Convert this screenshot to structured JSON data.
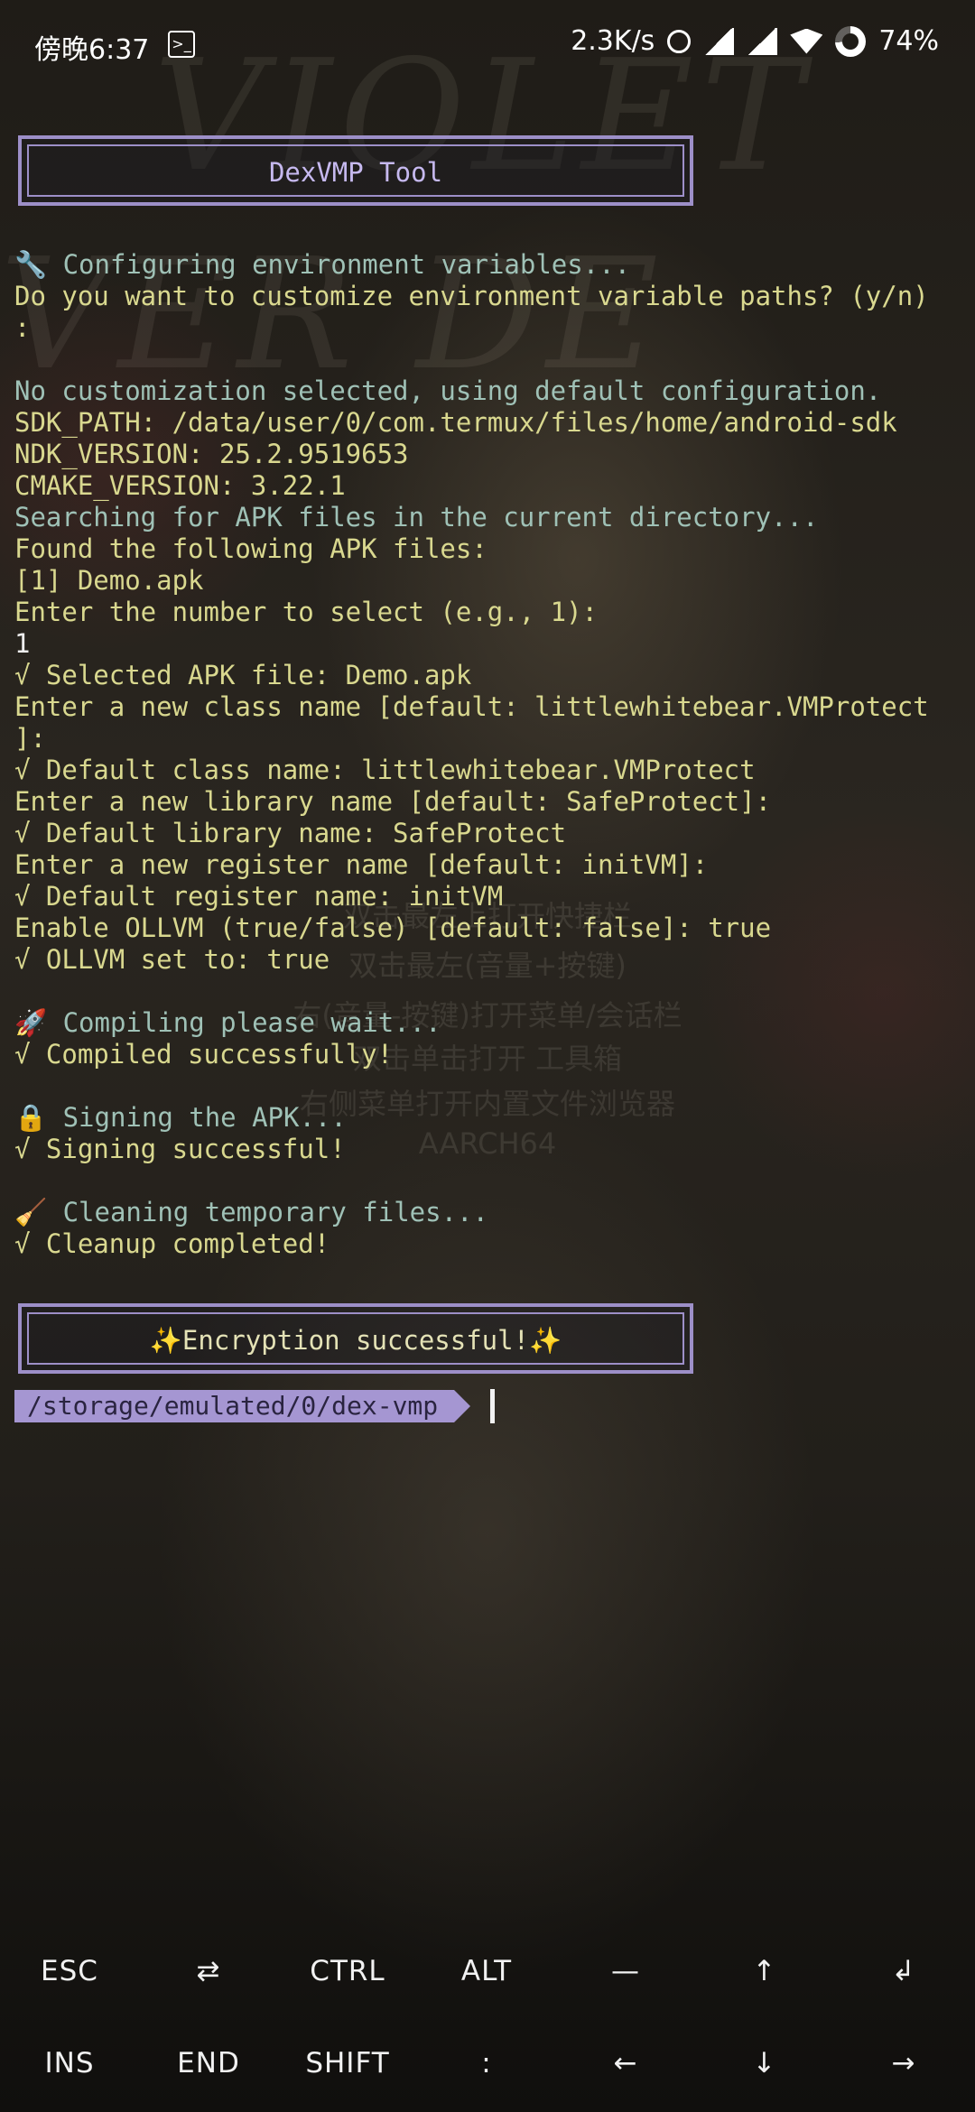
{
  "status_bar": {
    "time": "傍晚6:37",
    "network_speed": "2.3K/s",
    "battery": "74%",
    "battery_level": 0.74,
    "icons": [
      "terminal-notification-icon",
      "alarm-icon",
      "signal-icon",
      "signal-icon",
      "wifi-icon",
      "battery-icon"
    ]
  },
  "background": {
    "watermark_top": "VIOLET",
    "watermark_mid": "VER        DE",
    "menu_hints": [
      "双击最左(音量+按键)",
      "右(音量-按键)打开菜单/会话栏",
      "双击单击打开 工具箱",
      "右侧菜单打开内置文件浏览器",
      "AARCH64"
    ],
    "menu_hint_top_partial": "双击最左上打开快捷栏"
  },
  "terminal": {
    "banner_title": "DexVMP Tool",
    "lines": [
      {
        "text": "🔧 Configuring environment variables...",
        "cls": "c-cyan"
      },
      {
        "text": "Do you want to customize environment variable paths? (y/n)",
        "cls": "c-yellow"
      },
      {
        "text": ":",
        "cls": "c-yellow"
      },
      {
        "text": "",
        "cls": ""
      },
      {
        "text": "No customization selected, using default configuration.",
        "cls": "c-cyan"
      },
      {
        "text": "SDK_PATH: /data/user/0/com.termux/files/home/android-sdk",
        "cls": "c-yellow"
      },
      {
        "text": "NDK_VERSION: 25.2.9519653",
        "cls": "c-yellow"
      },
      {
        "text": "CMAKE_VERSION: 3.22.1",
        "cls": "c-yellow"
      },
      {
        "text": "Searching for APK files in the current directory...",
        "cls": "c-cyan"
      },
      {
        "text": "Found the following APK files:",
        "cls": "c-yellow"
      },
      {
        "text": "[1] Demo.apk",
        "cls": "c-yellow"
      },
      {
        "text": "Enter the number to select (e.g., 1):",
        "cls": "c-yellow"
      },
      {
        "text": "1",
        "cls": "c-white"
      },
      {
        "text": "√ Selected APK file: Demo.apk",
        "cls": "c-yellow"
      },
      {
        "text": "Enter a new class name [default: littlewhitebear.VMProtect",
        "cls": "c-yellow"
      },
      {
        "text": "]:",
        "cls": "c-yellow"
      },
      {
        "text": "√ Default class name: littlewhitebear.VMProtect",
        "cls": "c-yellow"
      },
      {
        "text": "Enter a new library name [default: SafeProtect]:",
        "cls": "c-yellow"
      },
      {
        "text": "√ Default library name: SafeProtect",
        "cls": "c-yellow"
      },
      {
        "text": "Enter a new register name [default: initVM]:",
        "cls": "c-yellow"
      },
      {
        "text": "√ Default register name: initVM",
        "cls": "c-yellow"
      },
      {
        "text": "Enable OLLVM (true/false) [default: false]: true",
        "cls": "c-yellow"
      },
      {
        "text": "√ OLLVM set to: true",
        "cls": "c-yellow"
      },
      {
        "text": "",
        "cls": ""
      },
      {
        "text": "🚀 Compiling please wait...",
        "cls": "c-cyan"
      },
      {
        "text": "√ Compiled successfully!",
        "cls": "c-yellow"
      },
      {
        "text": "",
        "cls": ""
      },
      {
        "text": "🔒 Signing the APK...",
        "cls": "c-cyan"
      },
      {
        "text": "√ Signing successful!",
        "cls": "c-yellow"
      },
      {
        "text": "",
        "cls": ""
      },
      {
        "text": "🧹 Cleaning temporary files...",
        "cls": "c-cyan"
      },
      {
        "text": "√ Cleanup completed!",
        "cls": "c-yellow"
      }
    ],
    "success_banner": "✨Encryption successful!✨",
    "prompt_path": "/storage/emulated/0/dex-vmp"
  },
  "extra_keys": {
    "row1": [
      "ESC",
      "⇄",
      "CTRL",
      "ALT",
      "—",
      "↑",
      "↲"
    ],
    "row2": [
      "INS",
      "END",
      "SHIFT",
      ":",
      "←",
      "↓",
      "→"
    ],
    "row1_names": [
      "esc-key",
      "tab-key",
      "ctrl-key",
      "alt-key",
      "dash-key",
      "up-arrow-key",
      "enter-key"
    ],
    "row2_names": [
      "ins-key",
      "end-key",
      "shift-key",
      "colon-key",
      "left-arrow-key",
      "down-arrow-key",
      "right-arrow-key"
    ]
  }
}
